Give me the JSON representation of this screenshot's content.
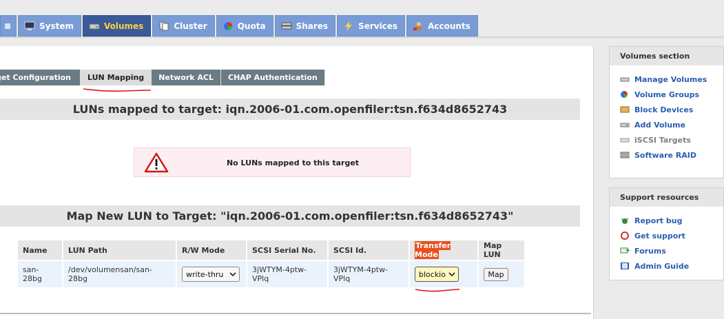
{
  "nav": {
    "tabs": [
      {
        "label": "System"
      },
      {
        "label": "Volumes"
      },
      {
        "label": "Cluster"
      },
      {
        "label": "Quota"
      },
      {
        "label": "Shares"
      },
      {
        "label": "Services"
      },
      {
        "label": "Accounts"
      }
    ],
    "active": "Volumes"
  },
  "subtabs": [
    "Target Configuration",
    "LUN Mapping",
    "Network ACL",
    "CHAP Authentication"
  ],
  "mapped_title": "LUNs mapped to target: iqn.2006-01.com.openfiler:tsn.f634d8652743",
  "warning": "No LUNs mapped to this target",
  "map_title": "Map New LUN to Target: \"iqn.2006-01.com.openfiler:tsn.f634d8652743\"",
  "table": {
    "headers": [
      "Name",
      "LUN Path",
      "R/W Mode",
      "SCSI Serial No.",
      "SCSI Id.",
      "Transfer Mode",
      "Map LUN"
    ],
    "row": {
      "name": "san-28bg",
      "path": "/dev/volumensan/san-28bg",
      "rw_mode": "write-thru",
      "serial": "3jWTYM-4ptw-VPlq",
      "scsi_id": "3jWTYM-4ptw-VPlq",
      "transfer_mode": "blockio",
      "map_label": "Map"
    }
  },
  "sidebar": {
    "volumes": {
      "title": "Volumes section",
      "items": [
        {
          "label": "Manage Volumes",
          "icon": "disk-icon"
        },
        {
          "label": "Volume Groups",
          "icon": "volume-group-icon"
        },
        {
          "label": "Block Devices",
          "icon": "block-device-icon"
        },
        {
          "label": "Add Volume",
          "icon": "add-disk-icon"
        },
        {
          "label": "iSCSI Targets",
          "icon": "iscsi-icon"
        },
        {
          "label": "Software RAID",
          "icon": "raid-icon"
        }
      ]
    },
    "support": {
      "title": "Support resources",
      "items": [
        {
          "label": "Report bug",
          "icon": "bug-icon"
        },
        {
          "label": "Get support",
          "icon": "support-icon"
        },
        {
          "label": "Forums",
          "icon": "forums-icon"
        },
        {
          "label": "Admin Guide",
          "icon": "book-icon"
        }
      ]
    }
  },
  "colors": {
    "nav_tab": "#7a9cd6",
    "nav_active": "#3a5a99",
    "link": "#2a5db0",
    "highlight": "#e8501e",
    "annotation": "#e0101e"
  }
}
